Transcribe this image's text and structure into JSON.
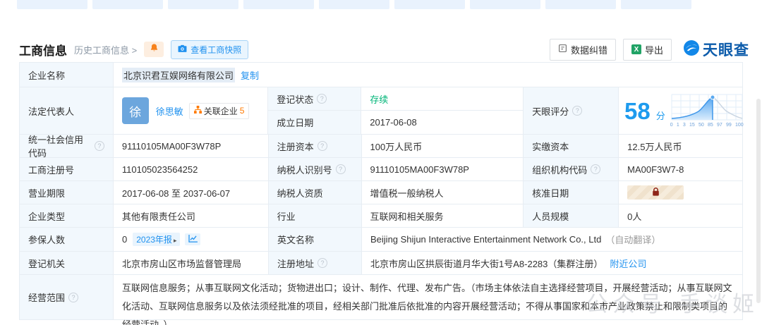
{
  "icons": {
    "help": "?",
    "excel": "X"
  },
  "header": {
    "title": "工商信息",
    "history_link": "历史工商信息 >",
    "snapshot_button": "查看工商快照"
  },
  "toolbar": {
    "correction_button": "数据纠错",
    "export_button": "导出",
    "logo_text": "天眼查"
  },
  "table": {
    "company_name": {
      "label": "企业名称",
      "value": "北京识君互娱网络有限公司",
      "copy": "复制"
    },
    "legal_rep": {
      "label": "法定代表人",
      "avatar": "徐",
      "name": "徐思敏",
      "badge_label": "关联企业",
      "badge_count": "5"
    },
    "reg_status": {
      "label": "登记状态",
      "value": "存续"
    },
    "est_date": {
      "label": "成立日期",
      "value": "2017-06-08"
    },
    "score": {
      "label": "天眼评分",
      "value": "58",
      "unit": "分",
      "ticks": [
        "0",
        "1",
        "3",
        "15",
        "50",
        "85",
        "97",
        "99",
        "100"
      ]
    },
    "uscc": {
      "label": "统一社会信用代码",
      "value": "91110105MA00F3W78P"
    },
    "reg_capital": {
      "label": "注册资本",
      "value": "100万人民币"
    },
    "paid_capital": {
      "label": "实缴资本",
      "value": "12.5万人民币"
    },
    "reg_number": {
      "label": "工商注册号",
      "value": "110105023564252"
    },
    "taxpayer_id": {
      "label": "纳税人识别号",
      "value": "91110105MA00F3W78P"
    },
    "org_code": {
      "label": "组织机构代码",
      "value": "MA00F3W7-8"
    },
    "business_term": {
      "label": "营业期限",
      "value": "2017-06-08 至 2037-06-07"
    },
    "taxpayer_quali": {
      "label": "纳税人资质",
      "value": "增值税一般纳税人"
    },
    "approval_date": {
      "label": "核准日期"
    },
    "company_type": {
      "label": "企业类型",
      "value": "其他有限责任公司"
    },
    "industry": {
      "label": "行业",
      "value": "互联网和相关服务"
    },
    "staff_size": {
      "label": "人员规模",
      "value": "0人"
    },
    "insured": {
      "label": "参保人数",
      "value": "0",
      "report_chip": "2023年报",
      "report_arrow": "▸"
    },
    "english_name": {
      "label": "英文名称",
      "value": "Beijing Shijun Interactive Entertainment Network Co., Ltd",
      "note": "（自动翻译）"
    },
    "reg_authority": {
      "label": "登记机关",
      "value": "北京市房山区市场监督管理局"
    },
    "reg_address": {
      "label": "注册地址",
      "value": "北京市房山区拱辰街道月华大街1号A8-2283（集群注册）",
      "nearby": "附近公司"
    },
    "business_scope": {
      "label": "经营范围",
      "value": "互联网信息服务；从事互联网文化活动；货物进出口；设计、制作、代理、发布广告。（市场主体依法自主选择经营项目，开展经营活动；从事互联网文化活动、互联网信息服务以及依法须经批准的项目，经相关部门批准后依批准的内容开展经营活动；不得从事国家和本市产业政策禁止和限制类项目的经营活动。）"
    }
  },
  "score_chart": {
    "type": "area",
    "description": "天眼评分正态分布曲线，当前企业得分58，位于峰值标记处",
    "x_ticks": [
      "0",
      "1",
      "3",
      "15",
      "50",
      "85",
      "97",
      "99",
      "100"
    ],
    "marker_value": 58
  },
  "watermark": "公众号·手谈姬"
}
